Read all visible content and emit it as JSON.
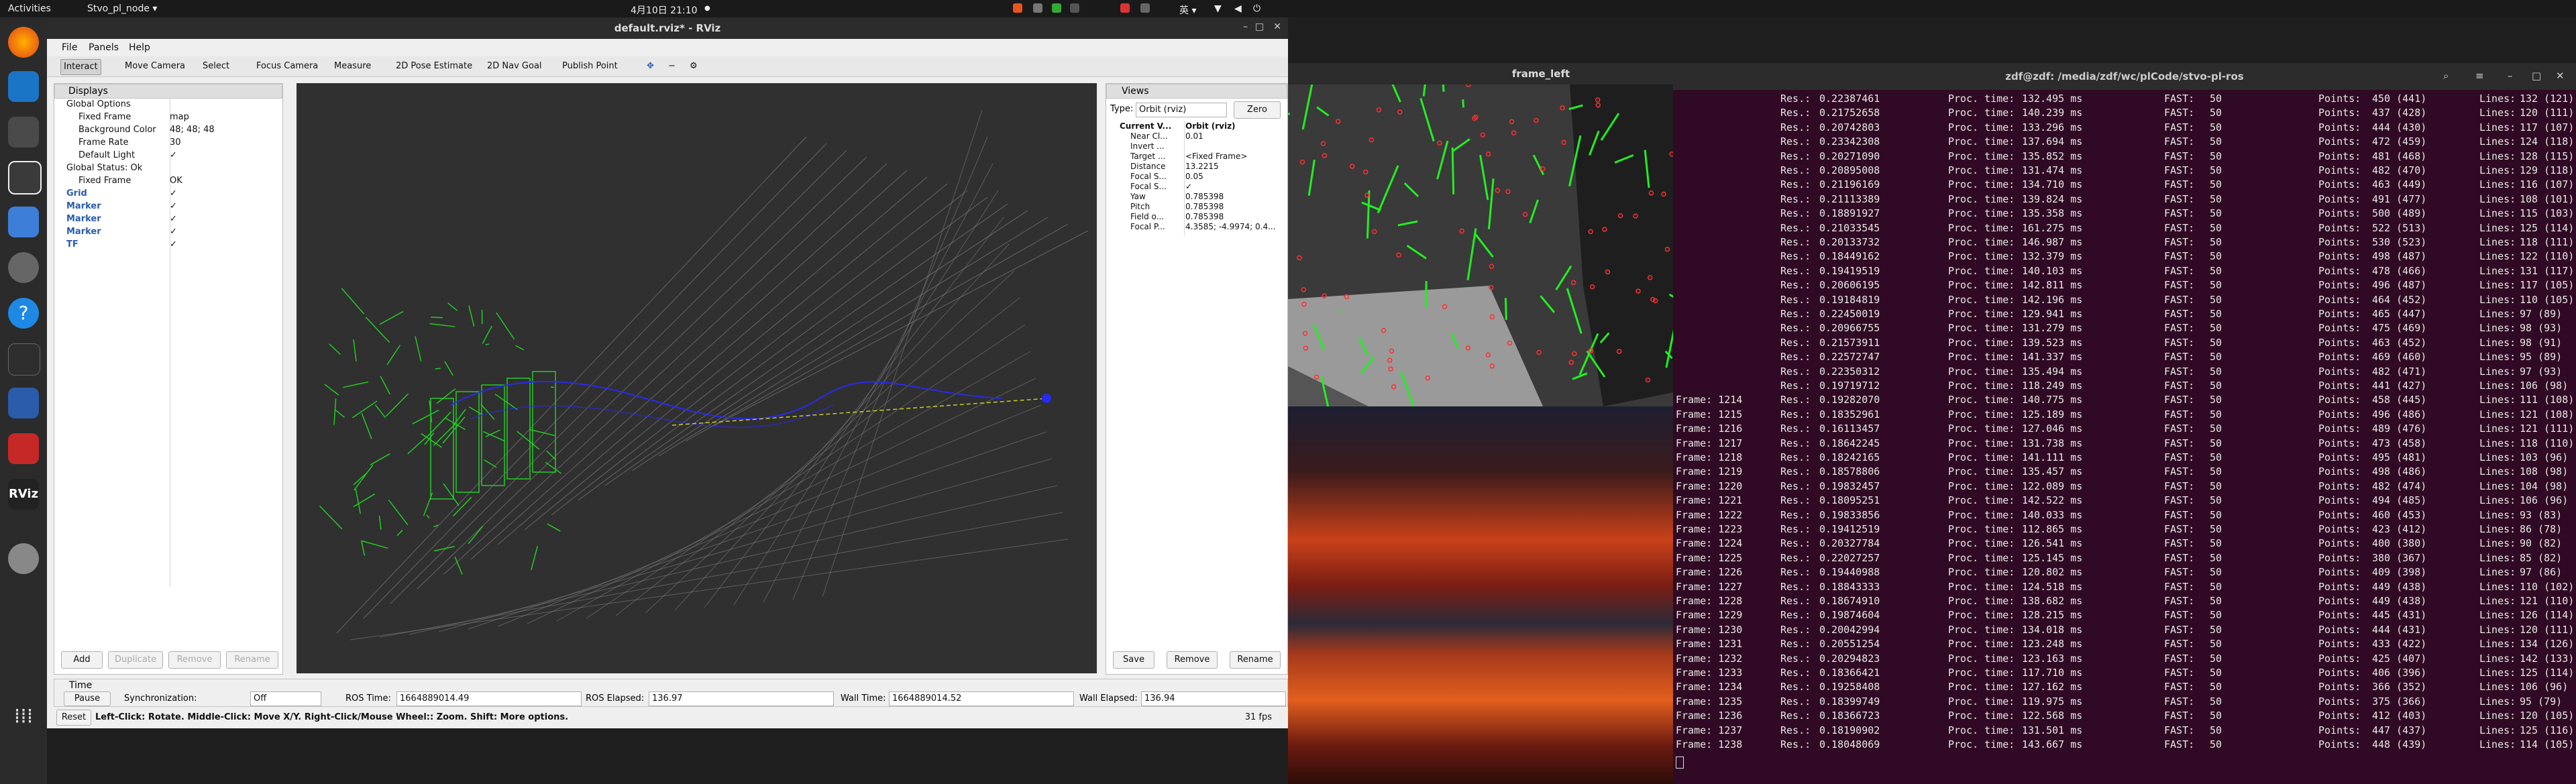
{
  "topbar": {
    "activities": "Activities",
    "app": "Stvo_pl_node ▾",
    "clock": "4月10日 21:10",
    "dot": "●",
    "input_method": "英 ▾"
  },
  "dock": {
    "apps": [
      "firefox-icon",
      "vscode-icon",
      "files-icon",
      "terminal-icon",
      "screenshot-icon",
      "settings-icon",
      "help-icon",
      "terminal2-icon",
      "libreoffice-icon",
      "rviz-icon",
      "disk-icon",
      "apps-grid-icon"
    ],
    "rviz_label": "RViz"
  },
  "rviz": {
    "title": "default.rviz* - RViz",
    "menu": [
      "File",
      "Panels",
      "Help"
    ],
    "tools": [
      "Interact",
      "Move Camera",
      "Select",
      "Focus Camera",
      "Measure",
      "2D Pose Estimate",
      "2D Nav Goal",
      "Publish Point"
    ],
    "displays": {
      "title": "Displays",
      "rows": [
        {
          "label": "Global Options",
          "value": ""
        },
        {
          "label": "Fixed Frame",
          "value": "map"
        },
        {
          "label": "Background Color",
          "value": "48; 48; 48"
        },
        {
          "label": "Frame Rate",
          "value": "30"
        },
        {
          "label": "Default Light",
          "value": "✓"
        },
        {
          "label": "Global Status: Ok",
          "value": ""
        },
        {
          "label": "Fixed Frame",
          "value": "OK"
        },
        {
          "label": "Grid",
          "value": "✓"
        },
        {
          "label": "Marker",
          "value": "✓"
        },
        {
          "label": "Marker",
          "value": "✓"
        },
        {
          "label": "Marker",
          "value": "✓"
        },
        {
          "label": "TF",
          "value": "✓"
        }
      ],
      "buttons": [
        "Add",
        "Duplicate",
        "Remove",
        "Rename"
      ]
    },
    "views": {
      "title": "Views",
      "type_label": "Type:",
      "type_value": "Orbit (rviz)",
      "zero": "Zero",
      "rows": [
        {
          "label": "Current V...",
          "value": "Orbit (rviz)"
        },
        {
          "label": "Near Cl...",
          "value": "0.01"
        },
        {
          "label": "Invert ...",
          "value": ""
        },
        {
          "label": "Target ...",
          "value": "<Fixed Frame>"
        },
        {
          "label": "Distance",
          "value": "13.2215"
        },
        {
          "label": "Focal S...",
          "value": "0.05"
        },
        {
          "label": "Focal S...",
          "value": "✓"
        },
        {
          "label": "Yaw",
          "value": "0.785398"
        },
        {
          "label": "Pitch",
          "value": "0.785398"
        },
        {
          "label": "Field o...",
          "value": "0.785398"
        },
        {
          "label": "Focal P...",
          "value": "4.3585; -4.9974; 0.4..."
        }
      ],
      "buttons": [
        "Save",
        "Remove",
        "Rename"
      ]
    },
    "time": {
      "title": "Time",
      "pause": "Pause",
      "sync_label": "Synchronization:",
      "sync_value": "Off",
      "ros_time_label": "ROS Time:",
      "ros_time": "1664889014.49",
      "ros_elapsed_label": "ROS Elapsed:",
      "ros_elapsed": "136.97",
      "wall_time_label": "Wall Time:",
      "wall_time": "1664889014.52",
      "wall_elapsed_label": "Wall Elapsed:",
      "wall_elapsed": "136.94"
    },
    "status": {
      "reset": "Reset",
      "help": "Left-Click: Rotate. Middle-Click: Move X/Y. Right-Click/Mouse Wheel:: Zoom. Shift: More options.",
      "fps": "31 fps"
    }
  },
  "frame_left": {
    "title": "frame_left"
  },
  "terminal": {
    "title": "zdf@zdf: /media/zdf/wc/plCode/stvo-pl-ros",
    "rows": [
      {
        "frame": "",
        "res": "0.22387461",
        "proc": "132.495 ms",
        "fast": "50",
        "points": "450 (441)",
        "lines": "132 (121)"
      },
      {
        "frame": "",
        "res": "0.21752658",
        "proc": "140.239 ms",
        "fast": "50",
        "points": "437 (428)",
        "lines": "120 (111)"
      },
      {
        "frame": "",
        "res": "0.20742803",
        "proc": "133.296 ms",
        "fast": "50",
        "points": "444 (430)",
        "lines": "117 (107)"
      },
      {
        "frame": "",
        "res": "0.23342308",
        "proc": "137.694 ms",
        "fast": "50",
        "points": "472 (459)",
        "lines": "124 (118)"
      },
      {
        "frame": "",
        "res": "0.20271090",
        "proc": "135.852 ms",
        "fast": "50",
        "points": "481 (468)",
        "lines": "128 (115)"
      },
      {
        "frame": "",
        "res": "0.20895008",
        "proc": "131.474 ms",
        "fast": "50",
        "points": "482 (470)",
        "lines": "129 (118)"
      },
      {
        "frame": "",
        "res": "0.21196169",
        "proc": "134.710 ms",
        "fast": "50",
        "points": "463 (449)",
        "lines": "116 (107)"
      },
      {
        "frame": "",
        "res": "0.21113389",
        "proc": "139.824 ms",
        "fast": "50",
        "points": "491 (477)",
        "lines": "108 (101)"
      },
      {
        "frame": "",
        "res": "0.18891927",
        "proc": "135.358 ms",
        "fast": "50",
        "points": "500 (489)",
        "lines": "115 (103)"
      },
      {
        "frame": "",
        "res": "0.21033545",
        "proc": "161.275 ms",
        "fast": "50",
        "points": "522 (513)",
        "lines": "125 (114)"
      },
      {
        "frame": "",
        "res": "0.20133732",
        "proc": "146.987 ms",
        "fast": "50",
        "points": "530 (523)",
        "lines": "118 (111)"
      },
      {
        "frame": "",
        "res": "0.18449162",
        "proc": "132.379 ms",
        "fast": "50",
        "points": "498 (487)",
        "lines": "122 (110)"
      },
      {
        "frame": "",
        "res": "0.19419519",
        "proc": "140.103 ms",
        "fast": "50",
        "points": "478 (466)",
        "lines": "131 (117)"
      },
      {
        "frame": "",
        "res": "0.20606195",
        "proc": "142.811 ms",
        "fast": "50",
        "points": "496 (487)",
        "lines": "117 (105)"
      },
      {
        "frame": "",
        "res": "0.19184819",
        "proc": "142.196 ms",
        "fast": "50",
        "points": "464 (452)",
        "lines": "110 (105)"
      },
      {
        "frame": "",
        "res": "0.22450019",
        "proc": "129.941 ms",
        "fast": "50",
        "points": "465 (447)",
        "lines": "97 (89)"
      },
      {
        "frame": "",
        "res": "0.20966755",
        "proc": "131.279 ms",
        "fast": "50",
        "points": "475 (469)",
        "lines": "98 (93)"
      },
      {
        "frame": "",
        "res": "0.21573911",
        "proc": "139.523 ms",
        "fast": "50",
        "points": "463 (452)",
        "lines": "98 (91)"
      },
      {
        "frame": "",
        "res": "0.22572747",
        "proc": "141.337 ms",
        "fast": "50",
        "points": "469 (460)",
        "lines": "95 (89)"
      },
      {
        "frame": "",
        "res": "0.22350312",
        "proc": "135.494 ms",
        "fast": "50",
        "points": "482 (471)",
        "lines": "97 (93)"
      },
      {
        "frame": "",
        "res": "0.19719712",
        "proc": "118.249 ms",
        "fast": "50",
        "points": "441 (427)",
        "lines": "106 (98)"
      },
      {
        "frame": "Frame: 1214",
        "res": "0.19282070",
        "proc": "140.775 ms",
        "fast": "50",
        "points": "458 (445)",
        "lines": "111 (108)"
      },
      {
        "frame": "Frame: 1215",
        "res": "0.18352961",
        "proc": "125.189 ms",
        "fast": "50",
        "points": "496 (486)",
        "lines": "121 (108)"
      },
      {
        "frame": "Frame: 1216",
        "res": "0.16113457",
        "proc": "127.046 ms",
        "fast": "50",
        "points": "489 (476)",
        "lines": "121 (111)"
      },
      {
        "frame": "Frame: 1217",
        "res": "0.18642245",
        "proc": "131.738 ms",
        "fast": "50",
        "points": "473 (458)",
        "lines": "118 (110)"
      },
      {
        "frame": "Frame: 1218",
        "res": "0.18242165",
        "proc": "141.111 ms",
        "fast": "50",
        "points": "495 (481)",
        "lines": "103 (96)"
      },
      {
        "frame": "Frame: 1219",
        "res": "0.18578806",
        "proc": "135.457 ms",
        "fast": "50",
        "points": "498 (486)",
        "lines": "108 (98)"
      },
      {
        "frame": "Frame: 1220",
        "res": "0.19832457",
        "proc": "122.089 ms",
        "fast": "50",
        "points": "482 (474)",
        "lines": "104 (98)"
      },
      {
        "frame": "Frame: 1221",
        "res": "0.18095251",
        "proc": "142.522 ms",
        "fast": "50",
        "points": "494 (485)",
        "lines": "106 (96)"
      },
      {
        "frame": "Frame: 1222",
        "res": "0.19833856",
        "proc": "140.033 ms",
        "fast": "50",
        "points": "460 (453)",
        "lines": "93 (83)"
      },
      {
        "frame": "Frame: 1223",
        "res": "0.19412519",
        "proc": "112.865 ms",
        "fast": "50",
        "points": "423 (412)",
        "lines": "86 (78)"
      },
      {
        "frame": "Frame: 1224",
        "res": "0.20327784",
        "proc": "126.541 ms",
        "fast": "50",
        "points": "400 (380)",
        "lines": "90 (82)"
      },
      {
        "frame": "Frame: 1225",
        "res": "0.22027257",
        "proc": "125.145 ms",
        "fast": "50",
        "points": "380 (367)",
        "lines": "85 (82)"
      },
      {
        "frame": "Frame: 1226",
        "res": "0.19440988",
        "proc": "120.802 ms",
        "fast": "50",
        "points": "409 (398)",
        "lines": "97 (86)"
      },
      {
        "frame": "Frame: 1227",
        "res": "0.18843333",
        "proc": "124.518 ms",
        "fast": "50",
        "points": "449 (438)",
        "lines": "110 (102)"
      },
      {
        "frame": "Frame: 1228",
        "res": "0.18674910",
        "proc": "138.682 ms",
        "fast": "50",
        "points": "449 (438)",
        "lines": "121 (110)"
      },
      {
        "frame": "Frame: 1229",
        "res": "0.19874604",
        "proc": "128.215 ms",
        "fast": "50",
        "points": "445 (431)",
        "lines": "126 (114)"
      },
      {
        "frame": "Frame: 1230",
        "res": "0.20042994",
        "proc": "134.018 ms",
        "fast": "50",
        "points": "444 (431)",
        "lines": "120 (111)"
      },
      {
        "frame": "Frame: 1231",
        "res": "0.20551254",
        "proc": "123.248 ms",
        "fast": "50",
        "points": "433 (422)",
        "lines": "134 (126)"
      },
      {
        "frame": "Frame: 1232",
        "res": "0.20294823",
        "proc": "123.163 ms",
        "fast": "50",
        "points": "425 (407)",
        "lines": "142 (133)"
      },
      {
        "frame": "Frame: 1233",
        "res": "0.18366421",
        "proc": "117.710 ms",
        "fast": "50",
        "points": "406 (396)",
        "lines": "125 (114)"
      },
      {
        "frame": "Frame: 1234",
        "res": "0.19258408",
        "proc": "127.162 ms",
        "fast": "50",
        "points": "366 (352)",
        "lines": "106 (96)"
      },
      {
        "frame": "Frame: 1235",
        "res": "0.18399749",
        "proc": "119.975 ms",
        "fast": "50",
        "points": "375 (366)",
        "lines": "95 (79)"
      },
      {
        "frame": "Frame: 1236",
        "res": "0.18366723",
        "proc": "122.568 ms",
        "fast": "50",
        "points": "412 (403)",
        "lines": "120 (105)"
      },
      {
        "frame": "Frame: 1237",
        "res": "0.18190902",
        "proc": "131.501 ms",
        "fast": "50",
        "points": "447 (437)",
        "lines": "125 (116)"
      },
      {
        "frame": "Frame: 1238",
        "res": "0.18048069",
        "proc": "143.667 ms",
        "fast": "50",
        "points": "448 (439)",
        "lines": "114 (105)"
      }
    ],
    "labels": {
      "res": "Res.:",
      "proc": "Proc. time:",
      "fast": "FAST:",
      "points": "Points:",
      "lines": "Lines:"
    }
  },
  "colors": {
    "topbar": "#1a1a1a",
    "dock": "#2b2b2b",
    "terminal_bg": "#300a24",
    "viewport": "#303030",
    "accent": "#e95420",
    "green": "#22dd22",
    "blue": "#2222cc"
  }
}
